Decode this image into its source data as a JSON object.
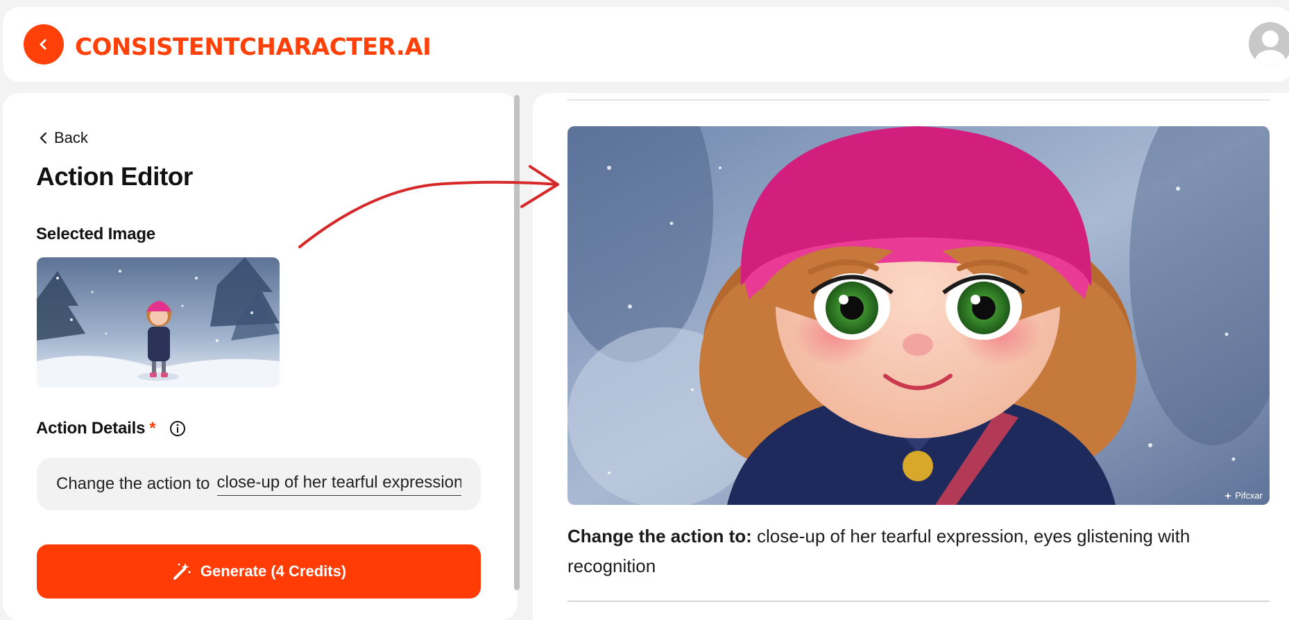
{
  "header": {
    "brand": "CONSISTENTCHARACTER.AI",
    "back_icon": "chevron-left-icon",
    "avatar_icon": "user-avatar-icon"
  },
  "editor": {
    "back_label": "Back",
    "title": "Action Editor",
    "selected_image_label": "Selected Image",
    "action_details_label": "Action Details",
    "required_mark": "*",
    "action_prefix": "Change the action to",
    "action_value": "close-up of her tearful expression, eyes glistening with recognition",
    "generate_label": "Generate (4 Credits)",
    "generate_icon": "magic-wand-icon",
    "info_icon": "info-icon"
  },
  "result": {
    "caption_label": "Change the action to:",
    "caption_text": " close-up of her tearful expression, eyes glistening with recognition",
    "watermark": "Pifcxar"
  },
  "colors": {
    "accent": "#ff4008",
    "button": "#ff3c05",
    "panel": "#ffffff",
    "background": "#f3f3f3",
    "annotation_arrow": "#d62828"
  }
}
